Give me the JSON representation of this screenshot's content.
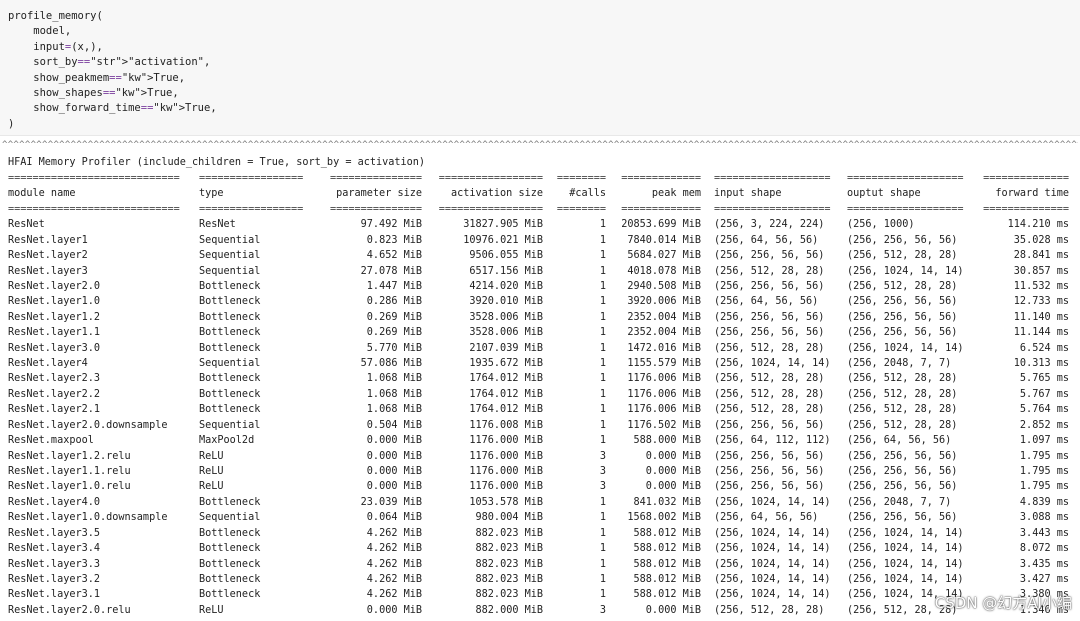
{
  "code": {
    "lines": [
      "profile_memory(",
      "    model,",
      "    input=(x,),",
      "    sort_by=\"activation\",",
      "    show_peakmem=True,",
      "    show_shapes=True,",
      "    show_forward_time=True,",
      ")"
    ]
  },
  "output": {
    "caret_line": "^^^^^^^^^^^^^^^^^^^^^^^^^^^^^^^^^^^^^^^^^^^^^^^^^^^^^^^^^^^^^^^^^^^^^^^^^^^^^^^^^^^^^^^^^^^^^^^^^^^^^^^^^^^^^^^^^^^^^^^^^^^^^^^^^^^^^^^^^^^^^^^^^^^^^^^^^^^^^^^^^^^^^^^^^^^^^^^^^^^^^^^^^^^^^^^^^^^^^^^^^^^^^^^^^^^^^^^^^^^^^^^^^^^^^^^^^^^^^^^^^^^^^^^",
    "title": "HFAI Memory Profiler (include_children = True, sort_by = activation)",
    "separators": [
      "============================",
      "=================",
      "===============",
      "=================",
      "========",
      "=============",
      "===================",
      "===================",
      "=============="
    ],
    "headers": [
      "module name",
      "type",
      "parameter size",
      "activation size",
      "#calls",
      "peak mem",
      "input shape",
      "ouptut shape",
      "forward time"
    ],
    "rows": [
      [
        "ResNet",
        "ResNet",
        "97.492 MiB",
        "31827.905 MiB",
        "1",
        "20853.699 MiB",
        "(256, 3, 224, 224)",
        "(256, 1000)",
        "114.210 ms"
      ],
      [
        "ResNet.layer1",
        "Sequential",
        "0.823 MiB",
        "10976.021 MiB",
        "1",
        "7840.014 MiB",
        "(256, 64, 56, 56)",
        "(256, 256, 56, 56)",
        "35.028 ms"
      ],
      [
        "ResNet.layer2",
        "Sequential",
        "4.652 MiB",
        "9506.055 MiB",
        "1",
        "5684.027 MiB",
        "(256, 256, 56, 56)",
        "(256, 512, 28, 28)",
        "28.841 ms"
      ],
      [
        "ResNet.layer3",
        "Sequential",
        "27.078 MiB",
        "6517.156 MiB",
        "1",
        "4018.078 MiB",
        "(256, 512, 28, 28)",
        "(256, 1024, 14, 14)",
        "30.857 ms"
      ],
      [
        "ResNet.layer2.0",
        "Bottleneck",
        "1.447 MiB",
        "4214.020 MiB",
        "1",
        "2940.508 MiB",
        "(256, 256, 56, 56)",
        "(256, 512, 28, 28)",
        "11.532 ms"
      ],
      [
        "ResNet.layer1.0",
        "Bottleneck",
        "0.286 MiB",
        "3920.010 MiB",
        "1",
        "3920.006 MiB",
        "(256, 64, 56, 56)",
        "(256, 256, 56, 56)",
        "12.733 ms"
      ],
      [
        "ResNet.layer1.2",
        "Bottleneck",
        "0.269 MiB",
        "3528.006 MiB",
        "1",
        "2352.004 MiB",
        "(256, 256, 56, 56)",
        "(256, 256, 56, 56)",
        "11.140 ms"
      ],
      [
        "ResNet.layer1.1",
        "Bottleneck",
        "0.269 MiB",
        "3528.006 MiB",
        "1",
        "2352.004 MiB",
        "(256, 256, 56, 56)",
        "(256, 256, 56, 56)",
        "11.144 ms"
      ],
      [
        "ResNet.layer3.0",
        "Bottleneck",
        "5.770 MiB",
        "2107.039 MiB",
        "1",
        "1472.016 MiB",
        "(256, 512, 28, 28)",
        "(256, 1024, 14, 14)",
        "6.524 ms"
      ],
      [
        "ResNet.layer4",
        "Sequential",
        "57.086 MiB",
        "1935.672 MiB",
        "1",
        "1155.579 MiB",
        "(256, 1024, 14, 14)",
        "(256, 2048, 7, 7)",
        "10.313 ms"
      ],
      [
        "ResNet.layer2.3",
        "Bottleneck",
        "1.068 MiB",
        "1764.012 MiB",
        "1",
        "1176.006 MiB",
        "(256, 512, 28, 28)",
        "(256, 512, 28, 28)",
        "5.765 ms"
      ],
      [
        "ResNet.layer2.2",
        "Bottleneck",
        "1.068 MiB",
        "1764.012 MiB",
        "1",
        "1176.006 MiB",
        "(256, 512, 28, 28)",
        "(256, 512, 28, 28)",
        "5.767 ms"
      ],
      [
        "ResNet.layer2.1",
        "Bottleneck",
        "1.068 MiB",
        "1764.012 MiB",
        "1",
        "1176.006 MiB",
        "(256, 512, 28, 28)",
        "(256, 512, 28, 28)",
        "5.764 ms"
      ],
      [
        "ResNet.layer2.0.downsample",
        "Sequential",
        "0.504 MiB",
        "1176.008 MiB",
        "1",
        "1176.502 MiB",
        "(256, 256, 56, 56)",
        "(256, 512, 28, 28)",
        "2.852 ms"
      ],
      [
        "ResNet.maxpool",
        "MaxPool2d",
        "0.000 MiB",
        "1176.000 MiB",
        "1",
        "588.000 MiB",
        "(256, 64, 112, 112)",
        "(256, 64, 56, 56)",
        "1.097 ms"
      ],
      [
        "ResNet.layer1.2.relu",
        "ReLU",
        "0.000 MiB",
        "1176.000 MiB",
        "3",
        "0.000 MiB",
        "(256, 256, 56, 56)",
        "(256, 256, 56, 56)",
        "1.795 ms"
      ],
      [
        "ResNet.layer1.1.relu",
        "ReLU",
        "0.000 MiB",
        "1176.000 MiB",
        "3",
        "0.000 MiB",
        "(256, 256, 56, 56)",
        "(256, 256, 56, 56)",
        "1.795 ms"
      ],
      [
        "ResNet.layer1.0.relu",
        "ReLU",
        "0.000 MiB",
        "1176.000 MiB",
        "3",
        "0.000 MiB",
        "(256, 256, 56, 56)",
        "(256, 256, 56, 56)",
        "1.795 ms"
      ],
      [
        "ResNet.layer4.0",
        "Bottleneck",
        "23.039 MiB",
        "1053.578 MiB",
        "1",
        "841.032 MiB",
        "(256, 1024, 14, 14)",
        "(256, 2048, 7, 7)",
        "4.839 ms"
      ],
      [
        "ResNet.layer1.0.downsample",
        "Sequential",
        "0.064 MiB",
        "980.004 MiB",
        "1",
        "1568.002 MiB",
        "(256, 64, 56, 56)",
        "(256, 256, 56, 56)",
        "3.088 ms"
      ],
      [
        "ResNet.layer3.5",
        "Bottleneck",
        "4.262 MiB",
        "882.023 MiB",
        "1",
        "588.012 MiB",
        "(256, 1024, 14, 14)",
        "(256, 1024, 14, 14)",
        "3.443 ms"
      ],
      [
        "ResNet.layer3.4",
        "Bottleneck",
        "4.262 MiB",
        "882.023 MiB",
        "1",
        "588.012 MiB",
        "(256, 1024, 14, 14)",
        "(256, 1024, 14, 14)",
        "8.072 ms"
      ],
      [
        "ResNet.layer3.3",
        "Bottleneck",
        "4.262 MiB",
        "882.023 MiB",
        "1",
        "588.012 MiB",
        "(256, 1024, 14, 14)",
        "(256, 1024, 14, 14)",
        "3.435 ms"
      ],
      [
        "ResNet.layer3.2",
        "Bottleneck",
        "4.262 MiB",
        "882.023 MiB",
        "1",
        "588.012 MiB",
        "(256, 1024, 14, 14)",
        "(256, 1024, 14, 14)",
        "3.427 ms"
      ],
      [
        "ResNet.layer3.1",
        "Bottleneck",
        "4.262 MiB",
        "882.023 MiB",
        "1",
        "588.012 MiB",
        "(256, 1024, 14, 14)",
        "(256, 1024, 14, 14)",
        "3.380 ms"
      ],
      [
        "ResNet.layer2.0.relu",
        "ReLU",
        "0.000 MiB",
        "882.000 MiB",
        "3",
        "0.000 MiB",
        "(256, 512, 28, 28)",
        "(256, 512, 28, 28)",
        "1.346 ms"
      ]
    ]
  },
  "watermark": "CSDN @幻方AI小编"
}
